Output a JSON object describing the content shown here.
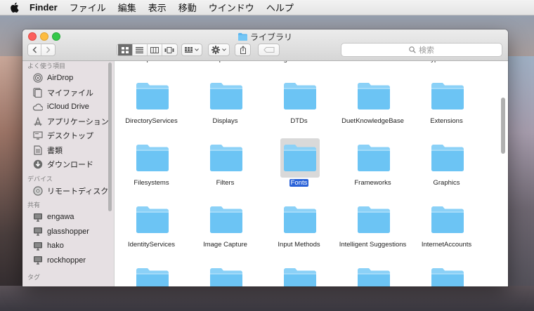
{
  "menubar": {
    "app": "Finder",
    "items": [
      "ファイル",
      "編集",
      "表示",
      "移動",
      "ウインドウ",
      "ヘルプ"
    ]
  },
  "window": {
    "title": "ライブラリ",
    "search_placeholder": "検索",
    "view_modes": [
      "icon",
      "list",
      "column",
      "cover-flow"
    ],
    "active_view": "icon"
  },
  "sidebar": {
    "favorites_header": "よく使う項目",
    "favorites": [
      {
        "label": "AirDrop",
        "icon": "airdrop-icon"
      },
      {
        "label": "マイファイル",
        "icon": "all-files-icon"
      },
      {
        "label": "iCloud Drive",
        "icon": "cloud-icon"
      },
      {
        "label": "アプリケーション",
        "icon": "applications-icon"
      },
      {
        "label": "デスクトップ",
        "icon": "desktop-icon"
      },
      {
        "label": "書類",
        "icon": "document-icon"
      },
      {
        "label": "ダウンロード",
        "icon": "download-icon"
      }
    ],
    "devices_header": "デバイス",
    "devices": [
      {
        "label": "リモートディスク",
        "icon": "disc-icon"
      }
    ],
    "shared_header": "共有",
    "shared": [
      {
        "label": "engawa",
        "icon": "display-icon"
      },
      {
        "label": "glasshopper",
        "icon": "display-icon"
      },
      {
        "label": "hako",
        "icon": "display-icon"
      },
      {
        "label": "rockhopper",
        "icon": "display-icon"
      }
    ],
    "tags_header": "タグ"
  },
  "files": {
    "top_partial": [
      "Components",
      "Compositions",
      "ConfigurationProfiles",
      "CoreServices",
      "CryptoTokenKit"
    ],
    "rows": [
      [
        "DirectoryServices",
        "Displays",
        "DTDs",
        "DuetKnowledgeBase",
        "Extensions"
      ],
      [
        "Filesystems",
        "Filters",
        "Fonts",
        "Frameworks",
        "Graphics"
      ],
      [
        "IdentityServices",
        "Image Capture",
        "Input Methods",
        "Intelligent Suggestions",
        "InternetAccounts"
      ]
    ],
    "selected": "Fonts",
    "colors": {
      "folder": "#6cc4f4",
      "folder_tab": "#8bd1f7",
      "selection": "#2a62d8"
    }
  }
}
